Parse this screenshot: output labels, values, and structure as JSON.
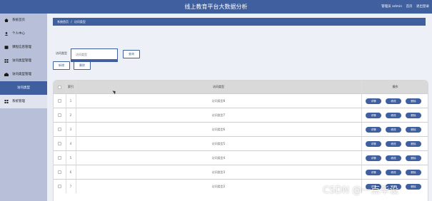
{
  "header": {
    "title": "线上教育平台大数据分析",
    "user_label": "管理员 admin",
    "home_link": "首页",
    "logout": "退出登录"
  },
  "sidebar": {
    "items": [
      {
        "label": "系统首页",
        "icon": "home-icon"
      },
      {
        "label": "个人中心",
        "icon": "user-icon"
      },
      {
        "label": "课程信息管理",
        "icon": "book-icon"
      },
      {
        "label": "访问类型管理",
        "icon": "grid-icon"
      },
      {
        "label": "访问类型管理",
        "icon": "grid-icon"
      },
      {
        "label": "访问类型",
        "icon": ""
      },
      {
        "label": "系统管理",
        "icon": "grid-icon"
      }
    ]
  },
  "breadcrumb": {
    "home": "系统首页",
    "separator": "/",
    "current": "访问类型"
  },
  "search": {
    "label": "访问类型",
    "placeholder": "访问类型",
    "button": "查询"
  },
  "actions": {
    "add": "新增",
    "delete": "删除"
  },
  "table": {
    "headers": {
      "index": "索引",
      "type": "访问类型",
      "ops": "操作"
    },
    "rows": [
      {
        "index": "1",
        "type": "访问类型8"
      },
      {
        "index": "2",
        "type": "访问类型7"
      },
      {
        "index": "3",
        "type": "访问类型6"
      },
      {
        "index": "4",
        "type": "访问类型5"
      },
      {
        "index": "5",
        "type": "访问类型4"
      },
      {
        "index": "6",
        "type": "访问类型3"
      },
      {
        "index": "7",
        "type": "访问类型2"
      }
    ],
    "row_buttons": {
      "detail": "详情",
      "edit": "修改",
      "delete": "删除"
    }
  },
  "watermark": "CSDN @一点毕设",
  "colors": {
    "primary": "#3f5f9f",
    "sidebar": "#b7c0d8",
    "content_bg": "#edf1f7"
  }
}
